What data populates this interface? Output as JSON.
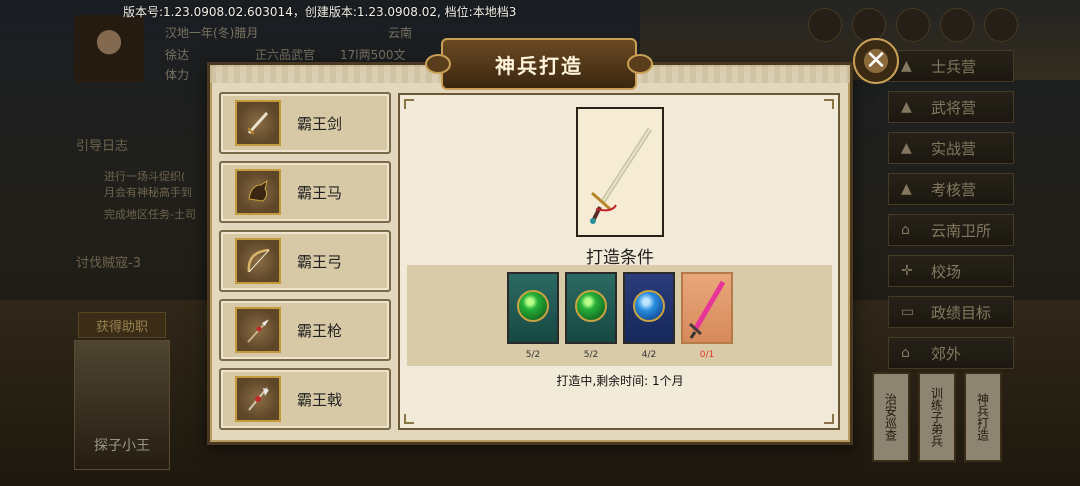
{
  "version_info": "版本号:1.23.0908.02.603014，创建版本:1.23.0908.02, 档位:本地档3",
  "background": {
    "date": "汉地一年(冬)腊月",
    "region": "云南",
    "hero_name": "徐达",
    "hero_rank": "正六品武官",
    "money": "17l两500文",
    "stamina": "体力",
    "menu": [
      "引导日志",
      "进行一场斗促织(",
      "月会有神秘高手到",
      "完成地区任务-土司",
      "讨伐贼寇-3"
    ],
    "hire_button": "获得助职",
    "scout_name": "探子小王",
    "side_buttons": [
      {
        "label": "士兵营",
        "icon": "tent-icon"
      },
      {
        "label": "武将营",
        "icon": "tent-icon"
      },
      {
        "label": "实战营",
        "icon": "tent-icon"
      },
      {
        "label": "考核营",
        "icon": "tent-icon"
      },
      {
        "label": "云南卫所",
        "icon": "building-icon"
      },
      {
        "label": "校场",
        "icon": "field-icon"
      },
      {
        "label": "政绩目标",
        "icon": "flag-icon"
      },
      {
        "label": "郊外",
        "icon": "temple-icon"
      }
    ],
    "vertical_buttons": [
      "治安巡查",
      "训练子弟兵",
      "神兵打造"
    ]
  },
  "modal": {
    "title": "神兵打造",
    "close_icon": "close-icon",
    "weapons": [
      {
        "name": "霸王剑",
        "icon": "sword-icon"
      },
      {
        "name": "霸王马",
        "icon": "horse-icon"
      },
      {
        "name": "霸王弓",
        "icon": "bow-icon"
      },
      {
        "name": "霸王枪",
        "icon": "spear-icon"
      },
      {
        "name": "霸王戟",
        "icon": "halberd-icon"
      }
    ],
    "selected_weapon_icon": "sword-icon",
    "condition_label": "打造条件",
    "materials": [
      {
        "count": "5/2",
        "icon": "green-gem-icon",
        "color": "#27b23a"
      },
      {
        "count": "5/2",
        "icon": "green-gem-icon",
        "color": "#27b23a"
      },
      {
        "count": "4/2",
        "icon": "blue-gem-icon",
        "color": "#2a8ee0"
      },
      {
        "count": "0/1",
        "icon": "pink-sword-icon",
        "color": "#e03a2a"
      }
    ],
    "status": "打造中,剩余时间: 1个月"
  },
  "colors": {
    "accent": "#c9a055",
    "panel": "#f2ead8",
    "warning": "#e03a2a"
  }
}
